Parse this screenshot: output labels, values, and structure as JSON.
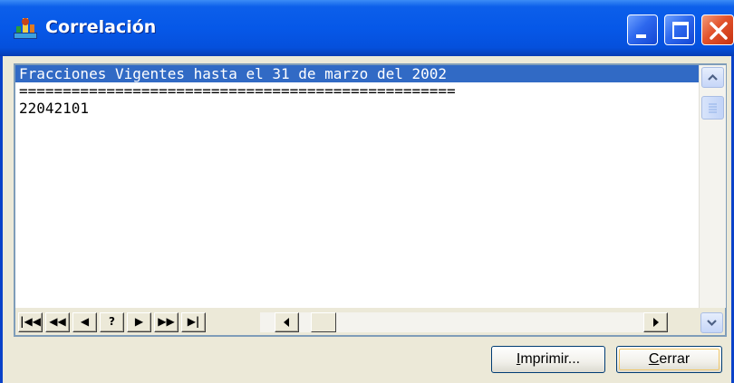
{
  "window": {
    "title": "Correlación",
    "icon": "app-icon",
    "controls": [
      "minimize-icon",
      "maximize-icon",
      "close-icon"
    ]
  },
  "listbox": {
    "lines": [
      "Fracciones Vigentes hasta el 31 de marzo del 2002",
      "==================================================",
      "22042101"
    ],
    "selected_line": 1
  },
  "navigator": {
    "buttons": [
      "|◀◀",
      "◀◀",
      "◀",
      "?",
      "▶",
      "▶▶",
      "▶|"
    ]
  },
  "buttons": {
    "print": {
      "mnemonic": "I",
      "rest": "mprimir..."
    },
    "close": {
      "mnemonic": "C",
      "rest": "errar"
    }
  },
  "colors": {
    "selection": "#316ac5",
    "title_bar": "#0658e8",
    "close_button": "#e2532c"
  }
}
